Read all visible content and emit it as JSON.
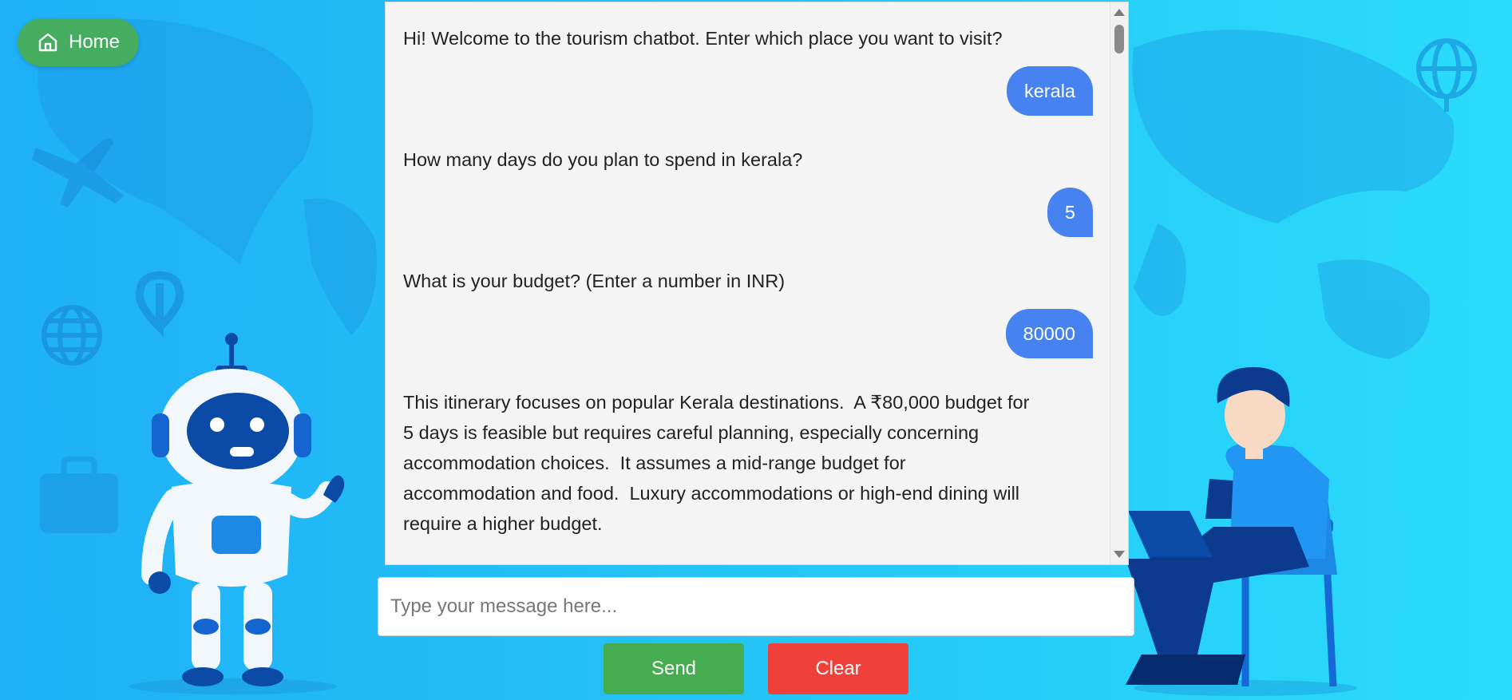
{
  "nav": {
    "home_label": "Home"
  },
  "chat": {
    "messages": [
      {
        "role": "bot",
        "text": "Hi! Welcome to the tourism chatbot. Enter which place you want to visit?"
      },
      {
        "role": "user",
        "text": "kerala"
      },
      {
        "role": "bot",
        "text": "How many days do you plan to spend in kerala?"
      },
      {
        "role": "user",
        "text": "5"
      },
      {
        "role": "bot",
        "text": "What is your budget? (Enter a number in INR)"
      },
      {
        "role": "user",
        "text": "80000"
      },
      {
        "role": "bot",
        "text": "This itinerary focuses on popular Kerala destinations.  A ₹80,000 budget for 5 days is feasible but requires careful planning, especially concerning accommodation choices.  It assumes a mid-range budget for accommodation and food.  Luxury accommodations or high-end dining will require a higher budget."
      }
    ]
  },
  "input": {
    "placeholder": "Type your message here...",
    "value": ""
  },
  "actions": {
    "send_label": "Send",
    "clear_label": "Clear"
  },
  "colors": {
    "home": "#45ad5f",
    "send": "#45ad4f",
    "clear": "#f0403a",
    "user_bubble": "#4683f0"
  }
}
